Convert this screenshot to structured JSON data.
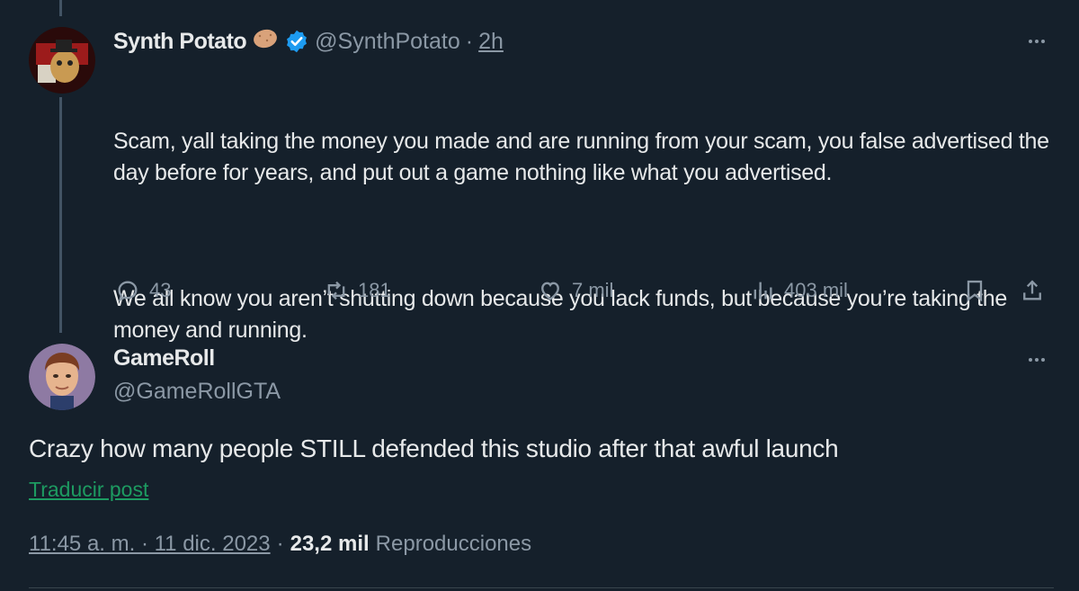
{
  "reply_tweet": {
    "display_name": "Synth Potato",
    "name_emoji": "potato-icon",
    "verified": true,
    "handle": "@SynthPotato",
    "separator": "·",
    "time": "2h",
    "body": [
      "Scam, yall taking the money you made and are running from your scam, you false advertised the day before for years, and put out a game nothing like what you advertised.",
      "We all know you aren’t shutting down because you lack funds, but because you’re taking the money and running."
    ],
    "stats": {
      "replies": "43",
      "reposts": "181",
      "likes": "7 mil",
      "views": "403 mil"
    }
  },
  "main_tweet": {
    "display_name": "GameRoll",
    "handle": "@GameRollGTA",
    "text": "Crazy how many people STILL defended this studio after that awful launch",
    "translate_label": "Traducir post",
    "timestamp": "11:45 a. m. · 11 dic. 2023",
    "separator": "·",
    "views_count": "23,2 mil",
    "views_label": "Reproducciones"
  },
  "colors": {
    "background": "#15202b",
    "text": "#e7e9ea",
    "muted": "#8b98a5",
    "verified": "#1d9bf0",
    "translate": "#1d9b61"
  }
}
